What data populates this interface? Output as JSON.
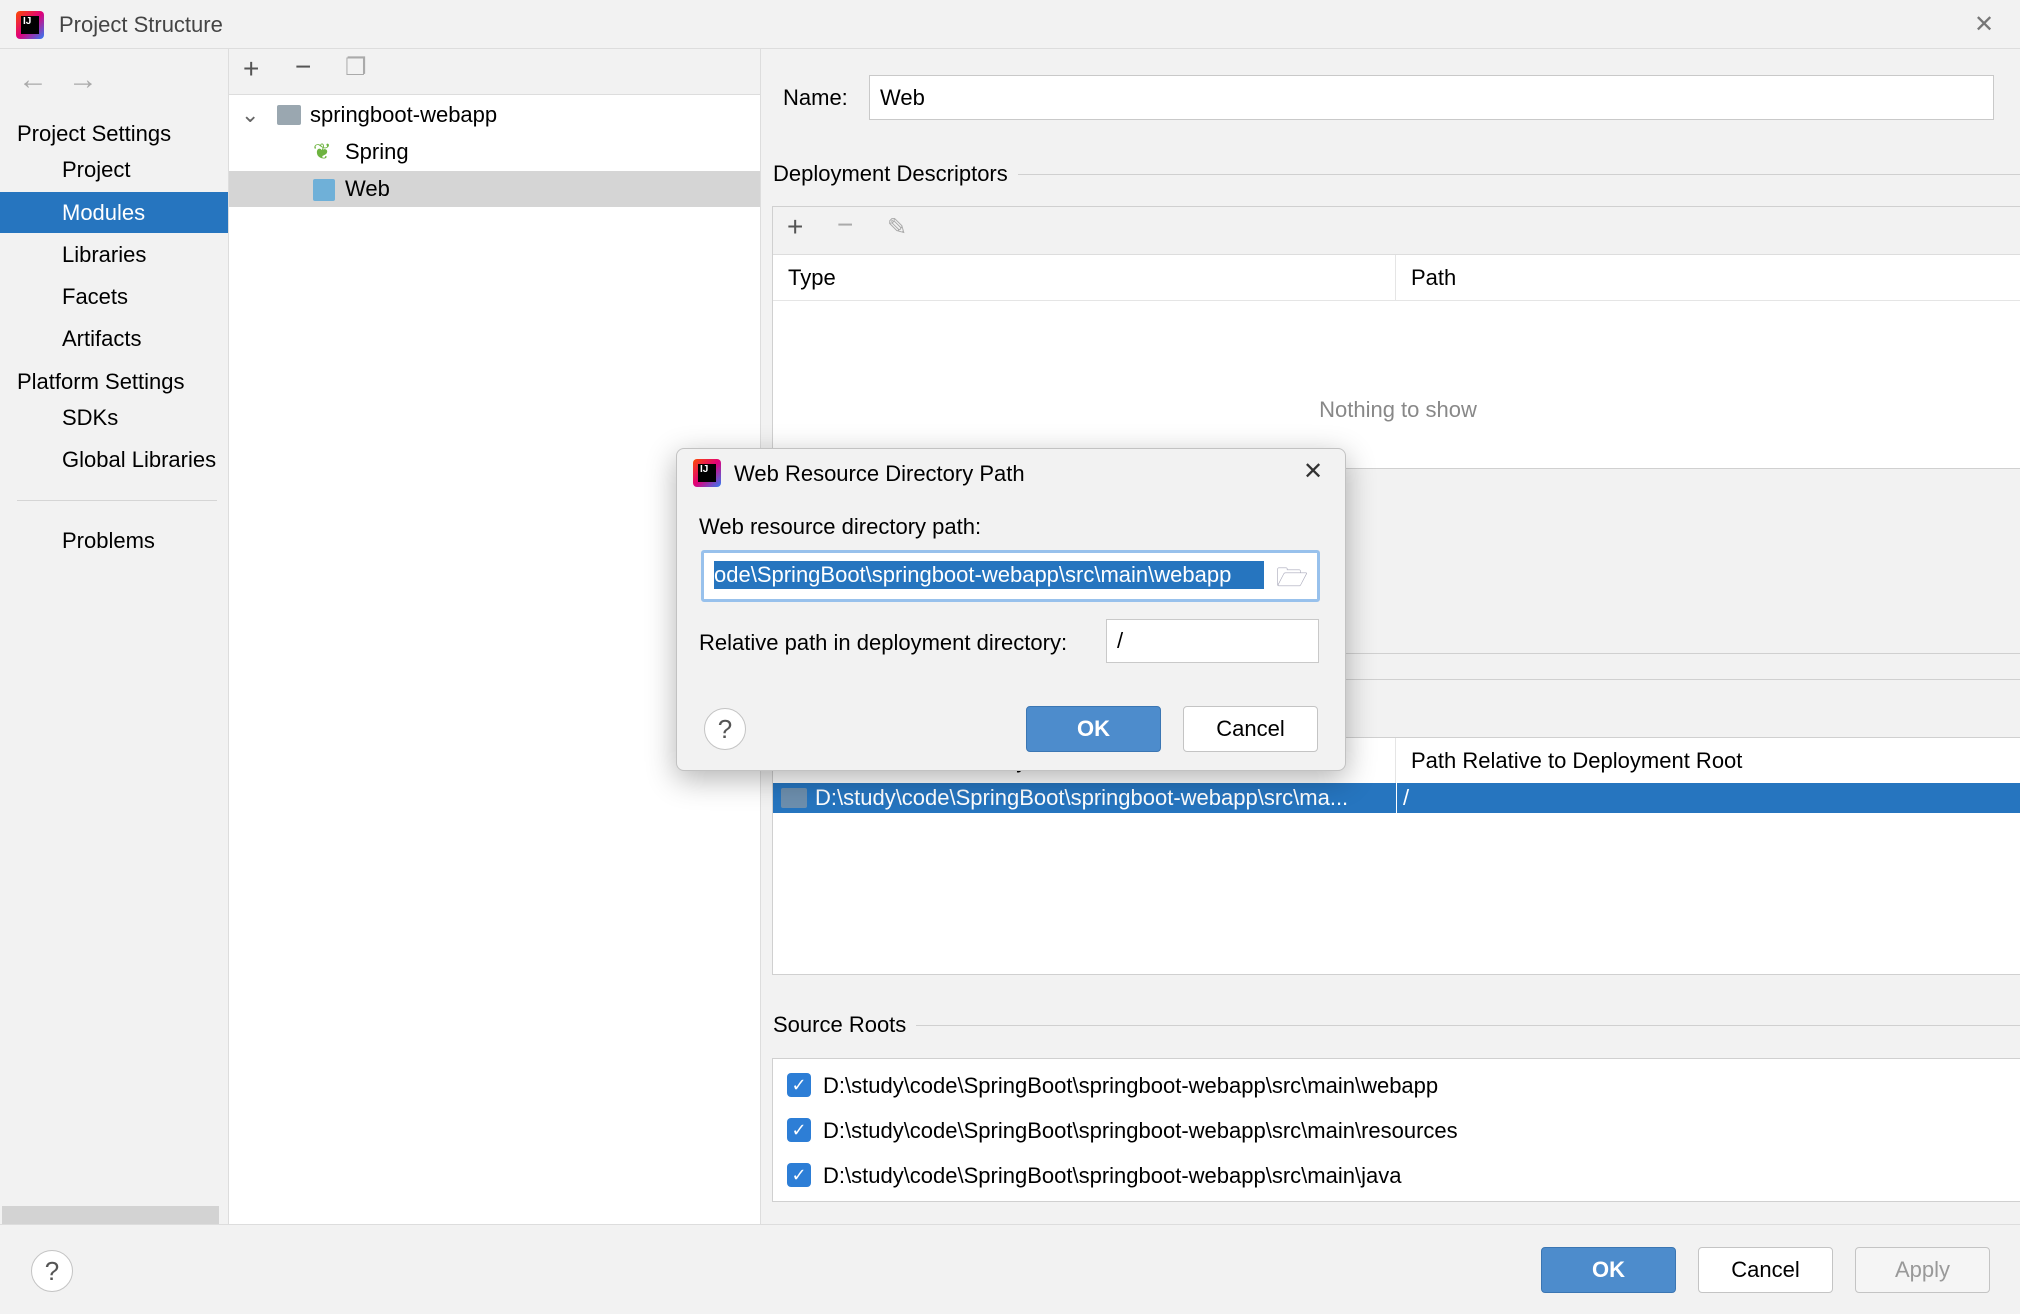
{
  "window": {
    "title": "Project Structure",
    "close": "✕"
  },
  "sidebar": {
    "project_settings": "Project Settings",
    "items": [
      {
        "label": "Project"
      },
      {
        "label": "Modules"
      },
      {
        "label": "Libraries"
      },
      {
        "label": "Facets"
      },
      {
        "label": "Artifacts"
      }
    ],
    "platform_settings": "Platform Settings",
    "platform_items": [
      {
        "label": "SDKs"
      },
      {
        "label": "Global Libraries"
      }
    ],
    "problems": "Problems",
    "selected": "Modules"
  },
  "tree": {
    "root": "springboot-webapp",
    "children": [
      {
        "label": "Spring"
      },
      {
        "label": "Web"
      }
    ],
    "selected": "Web"
  },
  "main": {
    "name_label": "Name:",
    "name_value": "Web",
    "deployment_descriptors": "Deployment Descriptors",
    "dd_columns": [
      "Type",
      "Path"
    ],
    "dd_empty": "Nothing to show",
    "web_dirs_columns": [
      "Web Resource Directory",
      "Path Relative to Deployment Root"
    ],
    "web_dirs_rows": [
      {
        "dir": "D:\\study\\code\\SpringBoot\\springboot-webapp\\src\\ma...",
        "path": "/"
      }
    ],
    "source_roots": "Source Roots",
    "source_root_items": [
      {
        "path": "D:\\study\\code\\SpringBoot\\springboot-webapp\\src\\main\\webapp",
        "checked": true
      },
      {
        "path": "D:\\study\\code\\SpringBoot\\springboot-webapp\\src\\main\\resources",
        "checked": true
      },
      {
        "path": "D:\\study\\code\\SpringBoot\\springboot-webapp\\src\\main\\java",
        "checked": true
      }
    ]
  },
  "footer": {
    "ok": "OK",
    "cancel": "Cancel",
    "apply": "Apply",
    "help": "?"
  },
  "dialog": {
    "title": "Web Resource Directory Path",
    "path_label": "Web resource directory path:",
    "path_value": "ode\\SpringBoot\\springboot-webapp\\src\\main\\webapp",
    "relative_label": "Relative path in deployment directory:",
    "relative_value": "/",
    "ok": "OK",
    "cancel": "Cancel",
    "help": "?",
    "close": "✕"
  },
  "colors": {
    "accent": "#2675bf",
    "button_default": "#4d8ccc",
    "checkbox": "#2d7ed6"
  }
}
